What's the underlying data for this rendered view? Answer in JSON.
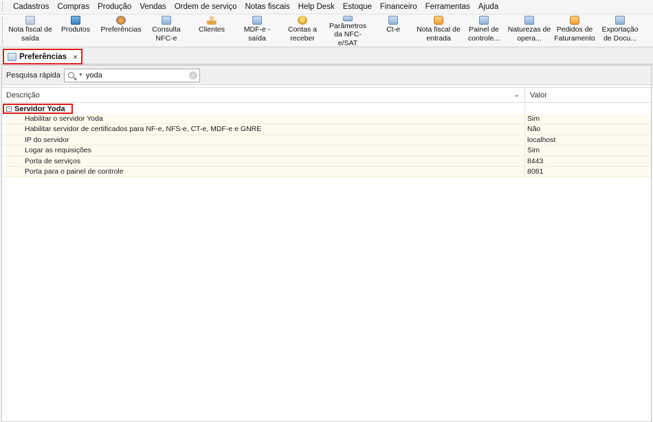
{
  "menu": {
    "items": [
      "Cadastros",
      "Compras",
      "Produção",
      "Vendas",
      "Ordem de serviço",
      "Notas fiscais",
      "Help Desk",
      "Estoque",
      "Financeiro",
      "Ferramentas",
      "Ajuda"
    ]
  },
  "toolbar": {
    "buttons": [
      {
        "label": "Nota fiscal de saída",
        "icon": "invoice-out-icon"
      },
      {
        "label": "Produtos",
        "icon": "products-icon"
      },
      {
        "label": "Preferências",
        "icon": "preferences-icon"
      },
      {
        "label": "Consulta NFC-e",
        "icon": "nfce-query-icon"
      },
      {
        "label": "Clientes",
        "icon": "clients-icon"
      },
      {
        "label": "MDF-e - saída",
        "icon": "mdfe-icon"
      },
      {
        "label": "Contas a receber",
        "icon": "receivables-icon"
      },
      {
        "label": "Parâmetros da NFC-e/SAT",
        "icon": "parameters-icon"
      },
      {
        "label": "Ct-e",
        "icon": "cte-icon"
      },
      {
        "label": "Nota fiscal de entrada",
        "icon": "invoice-in-icon"
      },
      {
        "label": "Painel de controle...",
        "icon": "control-panel-icon"
      },
      {
        "label": "Naturezas de opera...",
        "icon": "operations-icon"
      },
      {
        "label": "Pedidos de Faturamento",
        "icon": "billing-orders-icon"
      },
      {
        "label": "Exportação de Docu...",
        "icon": "export-docs-icon"
      }
    ]
  },
  "tab": {
    "label": "Preferências",
    "close": "×"
  },
  "search": {
    "label": "Pesquisa rápida",
    "value": "yoda"
  },
  "grid": {
    "columns": {
      "description": "Descrição",
      "value": "Valor"
    },
    "group": {
      "expand_symbol": "−",
      "label": "Servidor Yoda"
    },
    "rows": [
      {
        "description": "Habilitar o servidor Yoda",
        "value": "Sim"
      },
      {
        "description": "Habilitar servidor de certificados para NF-e, NFS-e, CT-e, MDF-e e GNRE",
        "value": "Não"
      },
      {
        "description": "IP do servidor",
        "value": "localhost"
      },
      {
        "description": "Logar as requisições",
        "value": "Sim"
      },
      {
        "description": "Porta de serviços",
        "value": "8443"
      },
      {
        "description": "Porta para o painel de controle",
        "value": "8081"
      }
    ]
  },
  "colors": {
    "highlight_border": "#e01b1b",
    "row_background": "#fdfbef"
  }
}
